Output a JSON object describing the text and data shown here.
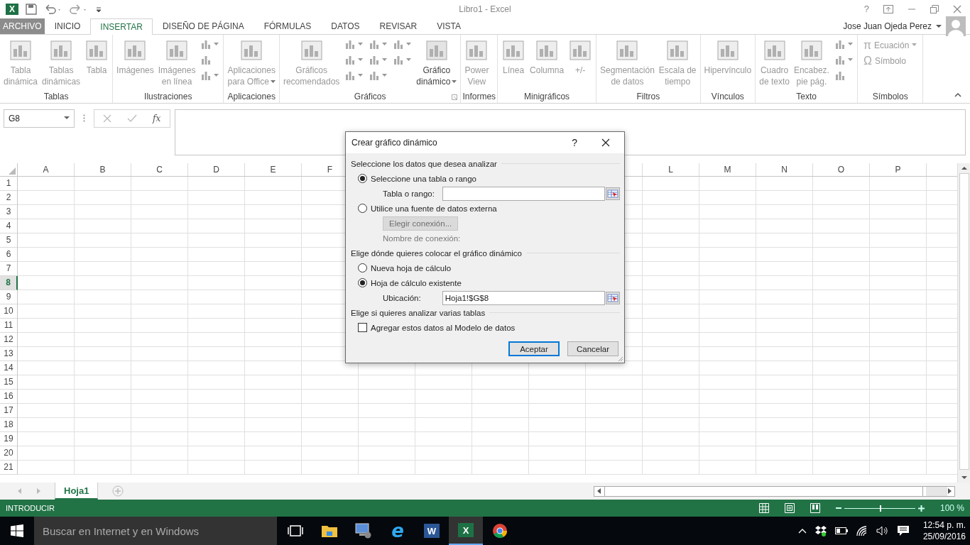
{
  "title_bar": {
    "logo": "X",
    "title": "Libro1 - Excel",
    "help": "?"
  },
  "tabs": [
    {
      "label": "ARCHIVO",
      "kind": "file",
      "selected": false
    },
    {
      "label": "INICIO",
      "kind": "tab",
      "selected": false
    },
    {
      "label": "INSERTAR",
      "kind": "tab",
      "selected": true
    },
    {
      "label": "DISEÑO DE PÁGINA",
      "kind": "tab",
      "selected": false
    },
    {
      "label": "FÓRMULAS",
      "kind": "tab",
      "selected": false
    },
    {
      "label": "DATOS",
      "kind": "tab",
      "selected": false
    },
    {
      "label": "REVISAR",
      "kind": "tab",
      "selected": false
    },
    {
      "label": "VISTA",
      "kind": "tab",
      "selected": false
    }
  ],
  "user": "Jose Juan Ojeda Perez",
  "ribbon": [
    {
      "label": "Tablas",
      "items": [
        {
          "kind": "large",
          "label": "Tabla\ndinámica",
          "disabled": true,
          "dropdown": false
        },
        {
          "kind": "large",
          "label": "Tablas\ndinámicas",
          "disabled": true,
          "dropdown": false
        },
        {
          "kind": "large",
          "label": "Tabla",
          "disabled": true,
          "dropdown": false
        }
      ]
    },
    {
      "label": "Ilustraciones",
      "items": [
        {
          "kind": "large",
          "label": "Imágenes",
          "disabled": true,
          "dropdown": false
        },
        {
          "kind": "large",
          "label": "Imágenes\nen línea",
          "disabled": true,
          "dropdown": false
        },
        {
          "kind": "icons",
          "icons": [
            {
              "dropdown": true
            },
            {
              "dropdown": false
            },
            {
              "dropdown": true
            }
          ]
        }
      ]
    },
    {
      "label": "Aplicaciones",
      "items": [
        {
          "kind": "large",
          "label": "Aplicaciones\npara Office",
          "disabled": true,
          "dropdown": true
        }
      ]
    },
    {
      "label": "Gráficos",
      "launcher": true,
      "items": [
        {
          "kind": "large",
          "label": "Gráficos\nrecomendados",
          "disabled": true,
          "dropdown": false
        },
        {
          "kind": "icons",
          "icons": [
            {
              "dropdown": true
            },
            {
              "dropdown": true
            },
            {
              "dropdown": true
            }
          ]
        },
        {
          "kind": "icons",
          "icons": [
            {
              "dropdown": true
            },
            {
              "dropdown": true
            },
            {
              "dropdown": true
            }
          ]
        },
        {
          "kind": "icons",
          "icons": [
            {
              "dropdown": true
            },
            {
              "dropdown": true
            }
          ]
        },
        {
          "kind": "large",
          "label": "Gráfico\ndinámico",
          "disabled": false,
          "dropdown": true
        }
      ]
    },
    {
      "label": "Informes",
      "items": [
        {
          "kind": "large",
          "label": "Power\nView",
          "disabled": true,
          "dropdown": false
        }
      ]
    },
    {
      "label": "Minigráficos",
      "items": [
        {
          "kind": "large",
          "label": "Línea",
          "disabled": true,
          "dropdown": false
        },
        {
          "kind": "large",
          "label": "Columna",
          "disabled": true,
          "dropdown": false
        },
        {
          "kind": "large",
          "label": "+/-",
          "disabled": true,
          "dropdown": false
        }
      ]
    },
    {
      "label": "Filtros",
      "items": [
        {
          "kind": "large",
          "label": "Segmentación\nde datos",
          "disabled": true,
          "dropdown": false
        },
        {
          "kind": "large",
          "label": "Escala de\ntiempo",
          "disabled": true,
          "dropdown": false
        }
      ]
    },
    {
      "label": "Vínculos",
      "items": [
        {
          "kind": "large",
          "label": "Hipervínculo",
          "disabled": true,
          "dropdown": false
        }
      ]
    },
    {
      "label": "Texto",
      "items": [
        {
          "kind": "large",
          "label": "Cuadro\nde texto",
          "disabled": true,
          "dropdown": false
        },
        {
          "kind": "large",
          "label": "Encabez.\npie pág.",
          "disabled": true,
          "dropdown": false
        },
        {
          "kind": "icons",
          "icons": [
            {
              "dropdown": true
            },
            {
              "dropdown": true
            },
            {
              "dropdown": false
            }
          ]
        }
      ]
    },
    {
      "label": "Símbolos",
      "items": [
        {
          "kind": "symbols",
          "entries": [
            {
              "symbol": "π",
              "label": "Ecuación",
              "dropdown": true
            },
            {
              "symbol": "Ω",
              "label": "Símbolo",
              "dropdown": false
            }
          ]
        }
      ]
    }
  ],
  "formula_bar": {
    "name_box": "G8",
    "fx": "fx"
  },
  "columns": [
    "A",
    "B",
    "C",
    "D",
    "E",
    "F",
    null,
    null,
    null,
    null,
    null,
    "L",
    "M",
    "N",
    "O",
    "P"
  ],
  "rows": [
    {
      "label": "1",
      "selected": false
    },
    {
      "label": "2",
      "selected": false
    },
    {
      "label": "3",
      "selected": false
    },
    {
      "label": "4",
      "selected": false
    },
    {
      "label": "5",
      "selected": false
    },
    {
      "label": "6",
      "selected": false
    },
    {
      "label": "7",
      "selected": false
    },
    {
      "label": "8",
      "selected": true
    },
    {
      "label": "9",
      "selected": false
    },
    {
      "label": "10",
      "selected": false
    },
    {
      "label": "11",
      "selected": false
    },
    {
      "label": "12",
      "selected": false
    },
    {
      "label": "13",
      "selected": false
    },
    {
      "label": "14",
      "selected": false
    },
    {
      "label": "15",
      "selected": false
    },
    {
      "label": "16",
      "selected": false
    },
    {
      "label": "17",
      "selected": false
    },
    {
      "label": "18",
      "selected": false
    },
    {
      "label": "19",
      "selected": false
    },
    {
      "label": "20",
      "selected": false
    },
    {
      "label": "21",
      "selected": false
    }
  ],
  "dialog": {
    "title": "Crear gráfico dinámico",
    "help": "?",
    "rows": [
      {
        "kind": "heading",
        "text": "Seleccione los datos que desea analizar"
      },
      {
        "kind": "radio",
        "label": "Seleccione una tabla o rango",
        "selected": true
      },
      {
        "kind": "field",
        "label": "Tabla o rango:"
      },
      {
        "kind": "radio",
        "label": "Utilice una fuente de datos externa",
        "selected": false
      },
      {
        "kind": "button",
        "label": "Elegir conexión...",
        "disabled": true
      },
      {
        "kind": "note",
        "text": "Nombre de conexión:"
      },
      {
        "kind": "heading",
        "text": "Elige dónde quieres colocar el gráfico dinámico"
      },
      {
        "kind": "radio",
        "label": "Nueva hoja de cálculo",
        "selected": false
      },
      {
        "kind": "radio",
        "label": "Hoja de cálculo existente",
        "selected": true
      },
      {
        "kind": "field",
        "label": "Ubicación:",
        "value": "Hoja1!$G$8"
      },
      {
        "kind": "heading",
        "text": "Elige si quieres analizar varias tablas"
      },
      {
        "kind": "checkbox",
        "label": "Agregar estos datos al Modelo de datos",
        "checked": false
      }
    ],
    "buttons": [
      {
        "label": "Aceptar",
        "default": true
      },
      {
        "label": "Cancelar",
        "default": false
      }
    ]
  },
  "sheets": [
    {
      "label": "Hoja1",
      "selected": true
    }
  ],
  "status_bar": {
    "mode": "INTRODUCIR",
    "zoom": "100 %",
    "zoom_slider": {
      "level": 0.5
    }
  },
  "taskbar": {
    "search": {
      "placeholder": "Buscar en Internet y en Windows"
    },
    "apps": [
      {
        "kind": "taskview",
        "selected": false
      },
      {
        "kind": "folder",
        "selected": false
      },
      {
        "kind": "remote",
        "selected": false
      },
      {
        "kind": "browser",
        "letter": "e",
        "selected": false
      },
      {
        "kind": "word",
        "letter": "W",
        "selected": false
      },
      {
        "kind": "excel",
        "letter": "X",
        "selected": true
      },
      {
        "kind": "chrome",
        "selected": false
      }
    ],
    "time": "12:54 p. m.",
    "date": "25/09/2016"
  }
}
